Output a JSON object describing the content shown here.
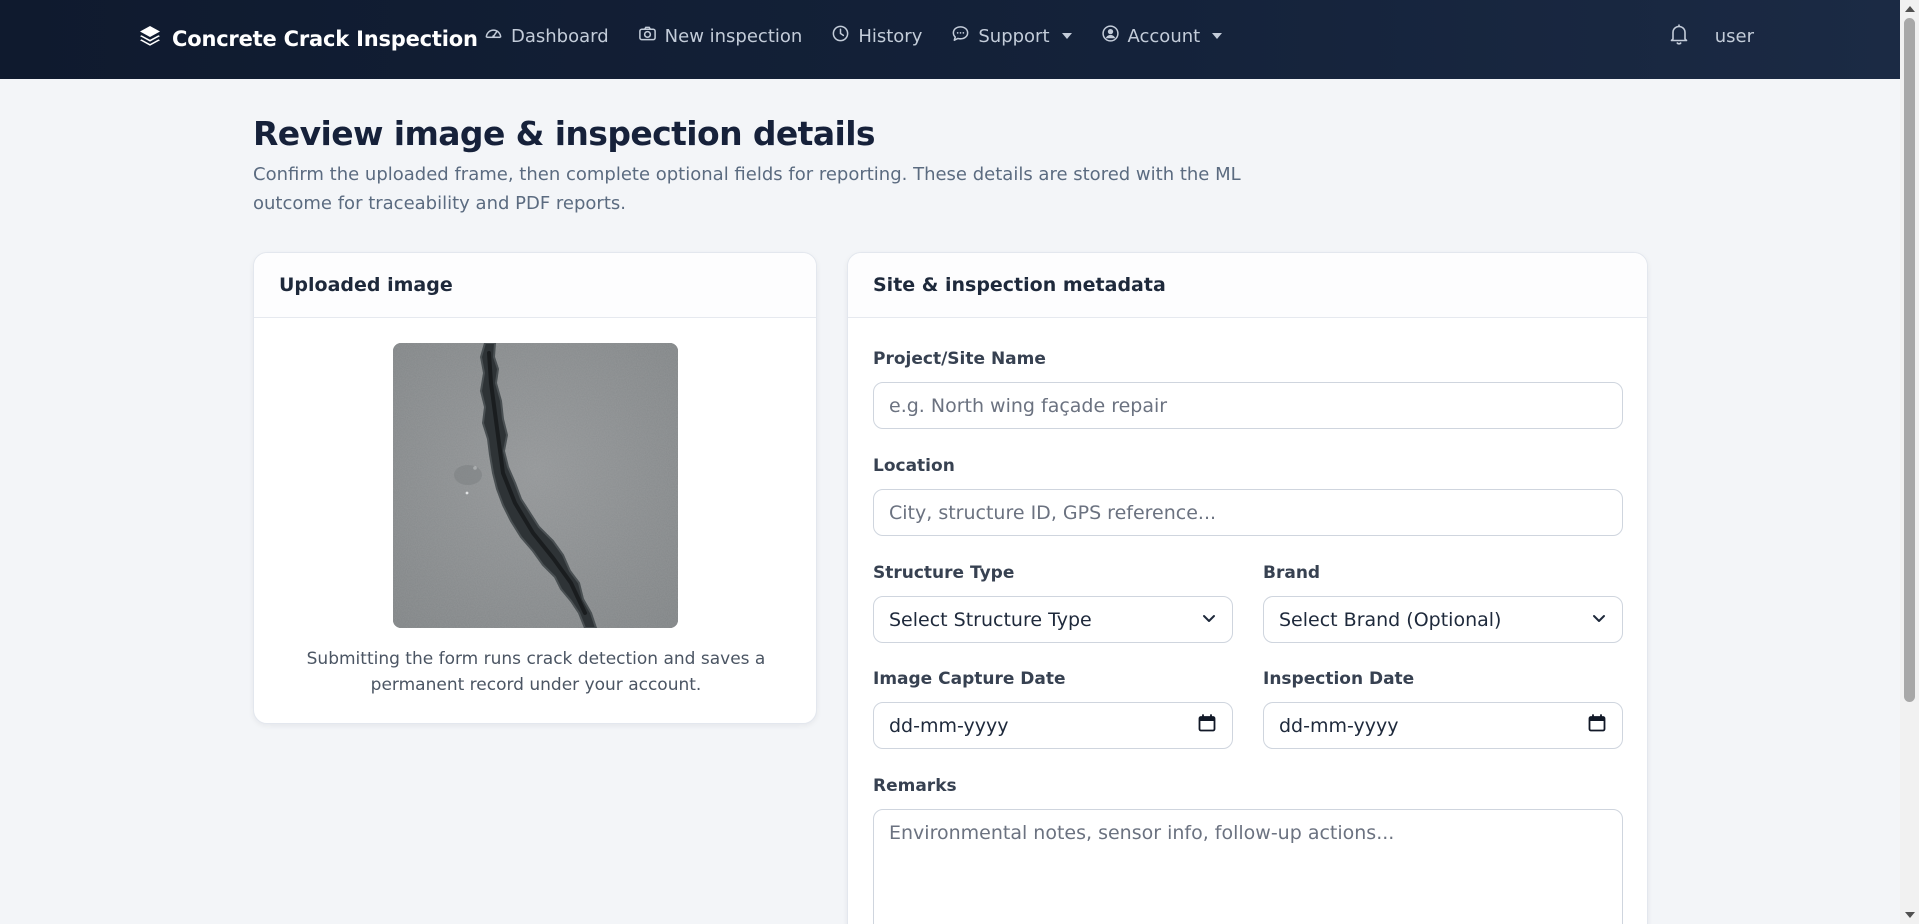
{
  "navbar": {
    "brand": "Concrete Crack Inspection",
    "links": [
      {
        "label": "Dashboard"
      },
      {
        "label": "New inspection"
      },
      {
        "label": "History"
      },
      {
        "label": "Support"
      },
      {
        "label": "Account"
      }
    ],
    "user": "user"
  },
  "header": {
    "title": "Review image & inspection details",
    "subtitle": "Confirm the uploaded frame, then complete optional fields for reporting. These details are stored with the ML outcome for traceability and PDF reports."
  },
  "upload_card": {
    "title": "Uploaded image",
    "caption": "Submitting the form runs crack detection and saves a permanent record under your account."
  },
  "metadata_card": {
    "title": "Site & inspection metadata",
    "project": {
      "label": "Project/Site Name",
      "placeholder": "e.g. North wing façade repair"
    },
    "location": {
      "label": "Location",
      "placeholder": "City, structure ID, GPS reference..."
    },
    "structure_type": {
      "label": "Structure Type",
      "value": "Select Structure Type"
    },
    "brand": {
      "label": "Brand",
      "value": "Select Brand (Optional)"
    },
    "capture_date": {
      "label": "Image Capture Date",
      "value": "dd-mm-yyyy"
    },
    "inspection_date": {
      "label": "Inspection Date",
      "value": "dd-mm-yyyy"
    },
    "remarks": {
      "label": "Remarks",
      "placeholder": "Environmental notes, sensor info, follow-up actions..."
    }
  },
  "colors": {
    "navbar_bg": "#0f1a2e",
    "page_bg": "#f3f5f8",
    "nav_text": "#c3ccd9"
  }
}
